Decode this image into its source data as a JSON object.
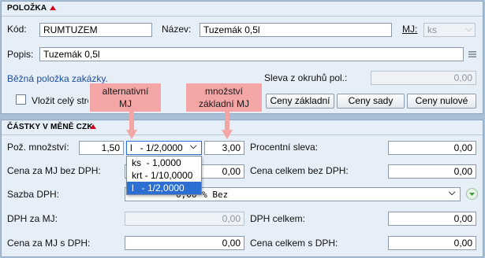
{
  "polozka": {
    "header": "POLOŽKA",
    "kod_label": "Kód:",
    "kod_value": "RUMTUZEM",
    "nazev_label": "Název:",
    "nazev_value": "Tuzemák 0,5l",
    "mj_label": "MJ:",
    "mj_value": "ks",
    "popis_label": "Popis:",
    "popis_value": "Tuzemák 0,5l",
    "link": "Běžná položka zakázky.",
    "sleva_label": "Sleva z okruhů pol.:",
    "sleva_value": "0,00",
    "checkbox_label": "Vložit celý stro",
    "btn_ceny_zakladni": "Ceny základní",
    "btn_ceny_sady": "Ceny sady",
    "btn_ceny_nulove": "Ceny nulové"
  },
  "castky": {
    "header": "ČÁSTKY V MĚNĚ CZK",
    "poz_mnozstvi_label": "Pož. množství:",
    "poz_mnozstvi_value": "1,50",
    "unit_select_value": "l   - 1/2,0000",
    "zakladni_mnozstvi_value": "3,00",
    "unit_options": [
      "ks  - 1,0000",
      "krt - 1/10,0000",
      "l   - 1/2,0000"
    ],
    "procentni_sleva_label": "Procentní sleva:",
    "procentni_sleva_value": "0,00",
    "cena_mj_bez_dph_label": "Cena za MJ bez DPH:",
    "cena_mj_bez_dph_value": "0,00",
    "cena_celkem_bez_dph_label": "Cena celkem bez DPH:",
    "cena_celkem_bez_dph_value": "0,00",
    "sazba_dph_label": "Sazba DPH:",
    "sazba_dph_value": "0,00 % Bez",
    "dph_mj_label": "DPH za MJ:",
    "dph_mj_value": "0,00",
    "dph_celkem_label": "DPH celkem:",
    "dph_celkem_value": "0,00",
    "cena_mj_s_dph_label": "Cena za MJ s DPH:",
    "cena_mj_s_dph_value": "0,00",
    "cena_celkem_s_dph_label": "Cena celkem s DPH:",
    "cena_celkem_s_dph_value": "0,00"
  },
  "callouts": {
    "alternativni": "alternativní MJ",
    "mnozstvi": "množství základní MJ"
  },
  "colors": {
    "callout": "#f4a5a5",
    "section_marker": "#d0021b",
    "link": "#1f4ea0",
    "selected_option": "#2a6fd1"
  }
}
